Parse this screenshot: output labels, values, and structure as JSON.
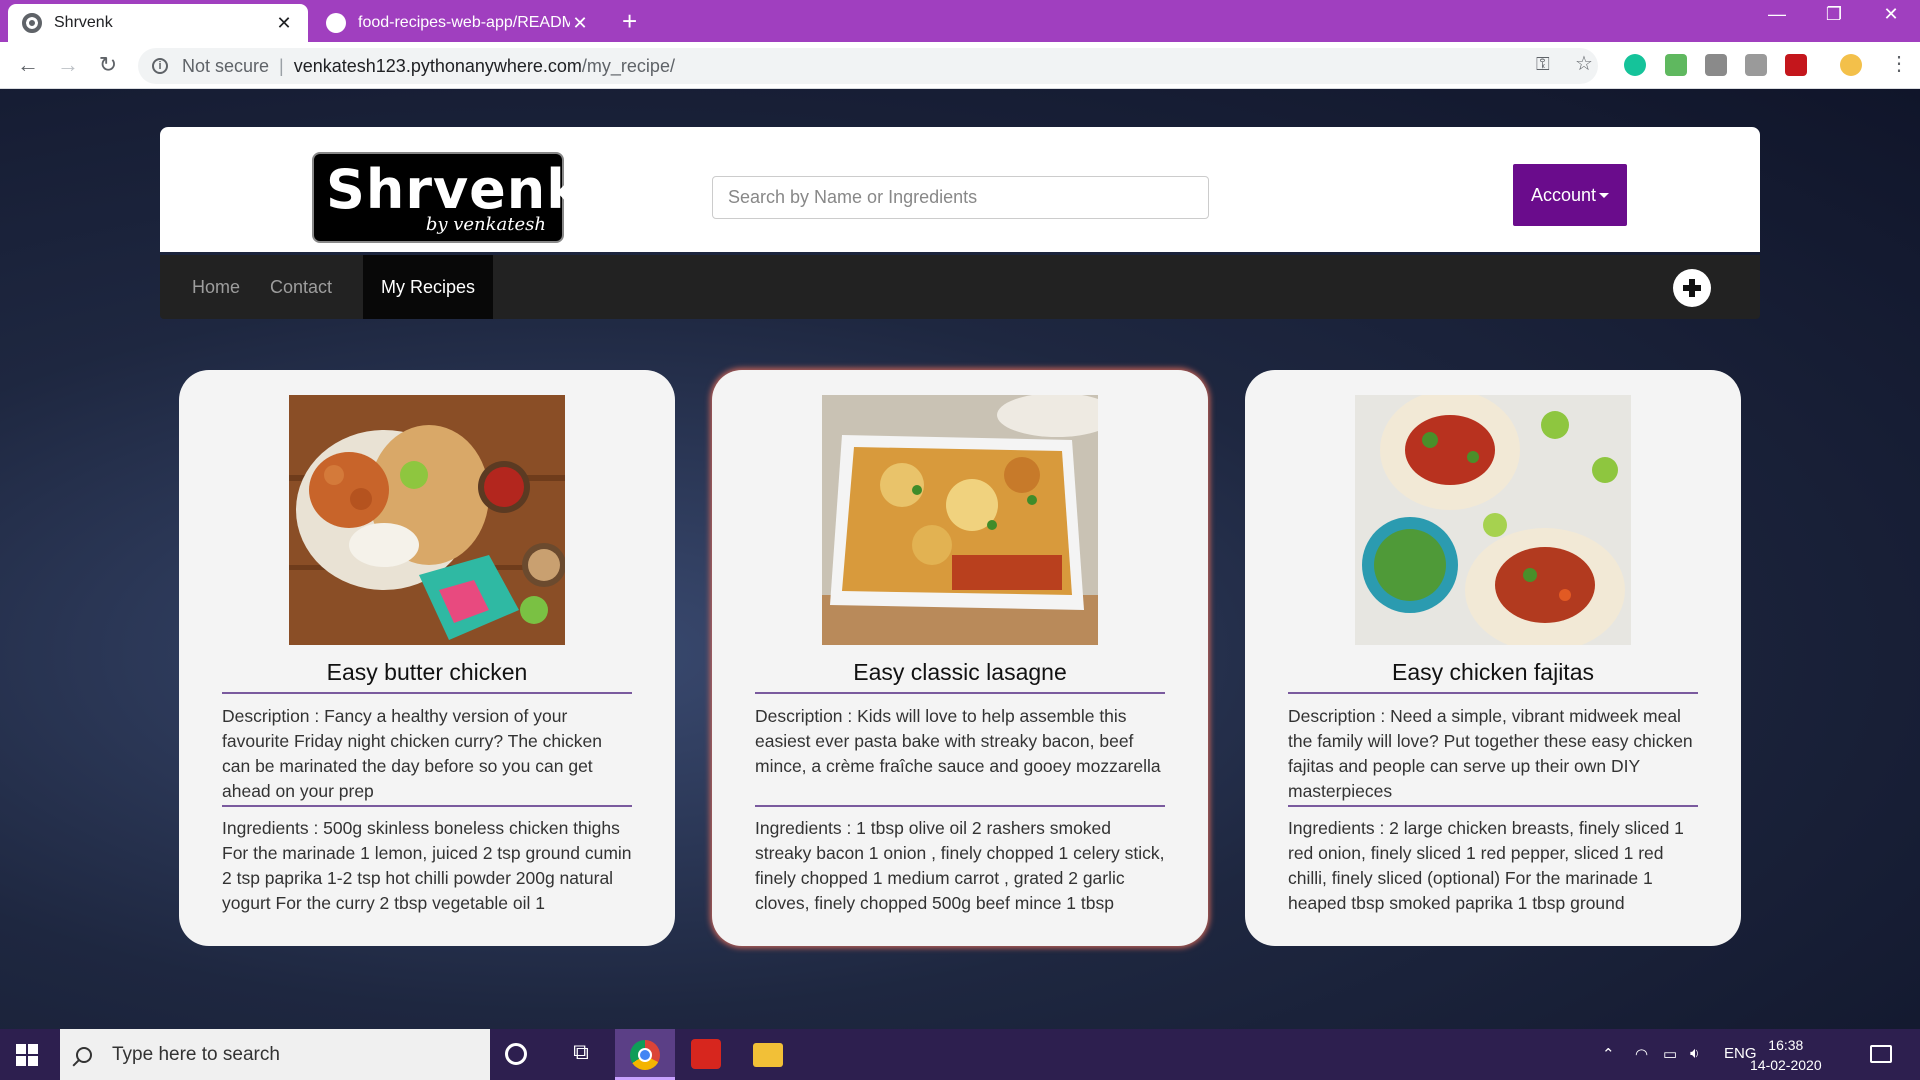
{
  "browser": {
    "tabs": [
      {
        "title": "Shrvenk",
        "active": true
      },
      {
        "title": "food-recipes-web-app/READMI",
        "active": false
      }
    ],
    "security_label": "Not secure",
    "url_host": "venkatesh123.pythonanywhere.com",
    "url_path": "/my_recipe/"
  },
  "site": {
    "logo_title": "Shrvenk",
    "logo_subtitle": "by venkatesh",
    "search_placeholder": "Search by Name or Ingredients",
    "account_label": "Account",
    "nav": [
      {
        "label": "Home",
        "active": false
      },
      {
        "label": "Contact",
        "active": false
      },
      {
        "label": "My Recipes",
        "active": true
      }
    ]
  },
  "recipes": [
    {
      "title": "Easy butter chicken",
      "description": "Description : Fancy a healthy version of your favourite Friday night chicken curry? The chicken can be marinated the day before so you can get ahead on your prep",
      "ingredients": "Ingredients : 500g skinless boneless chicken thighs For the marinade 1 lemon, juiced 2 tsp ground cumin 2 tsp paprika 1-2 tsp hot chilli powder 200g natural yogurt For the curry 2 tbsp vegetable oil 1"
    },
    {
      "title": "Easy classic lasagne",
      "description": "Description : Kids will love to help assemble this easiest ever pasta bake with streaky bacon, beef mince, a crème fraîche sauce and gooey mozzarella",
      "ingredients": "Ingredients : 1 tbsp olive oil 2 rashers smoked streaky bacon 1 onion , finely chopped 1 celery stick, finely chopped 1 medium carrot , grated 2 garlic cloves, finely chopped 500g beef mince 1 tbsp"
    },
    {
      "title": "Easy chicken fajitas",
      "description": "Description : Need a simple, vibrant midweek meal the family will love? Put together these easy chicken fajitas and people can serve up their own DIY masterpieces",
      "ingredients": "Ingredients : 2 large chicken breasts, finely sliced 1 red onion, finely sliced 1 red pepper, sliced 1 red chilli, finely sliced (optional) For the marinade 1 heaped tbsp smoked paprika 1 tbsp ground"
    }
  ],
  "taskbar": {
    "search_placeholder": "Type here to search",
    "language": "ENG",
    "time": "16:38",
    "date": "14-02-2020"
  },
  "colors": {
    "tab_bar": "#a03fbf",
    "account_button": "#6a0c8c",
    "navbar": "#222222",
    "taskbar": "#2d1f4f"
  }
}
